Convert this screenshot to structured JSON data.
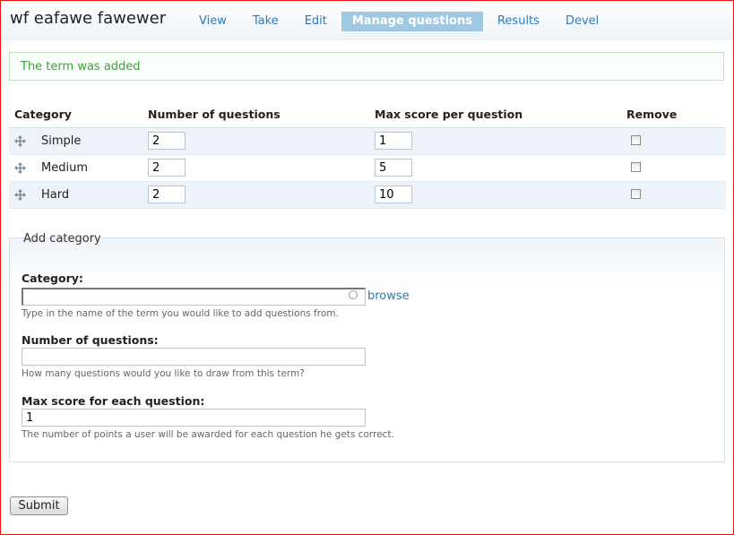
{
  "site": {
    "title": "wf eafawe fawewer"
  },
  "tabs": [
    {
      "label": "View",
      "active": false
    },
    {
      "label": "Take",
      "active": false
    },
    {
      "label": "Edit",
      "active": false
    },
    {
      "label": "Manage questions",
      "active": true
    },
    {
      "label": "Results",
      "active": false
    },
    {
      "label": "Devel",
      "active": false
    }
  ],
  "message": {
    "text": "The term was added"
  },
  "table": {
    "headers": {
      "category": "Category",
      "number": "Number of questions",
      "max_score": "Max score per question",
      "remove": "Remove"
    },
    "rows": [
      {
        "category": "Simple",
        "number": "2",
        "max_score": "1",
        "remove": false
      },
      {
        "category": "Medium",
        "number": "2",
        "max_score": "5",
        "remove": false
      },
      {
        "category": "Hard",
        "number": "2",
        "max_score": "10",
        "remove": false
      }
    ]
  },
  "add_category": {
    "legend": "Add category",
    "category": {
      "label": "Category:",
      "value": "",
      "browse": "browse",
      "description": "Type in the name of the term you would like to add questions from."
    },
    "number": {
      "label": "Number of questions:",
      "value": "",
      "description": "How many questions would you like to draw from this term?"
    },
    "max_score": {
      "label": "Max score for each question:",
      "value": "1",
      "description": "The number of points a user will be awarded for each question he gets correct."
    }
  },
  "submit": {
    "label": "Submit"
  },
  "colors": {
    "accent": "#2c7bb6",
    "active_tab": "#9ec8e3",
    "status_text": "#3aa13a",
    "frame_border": "#e11111",
    "row_alt": "#edf3f9"
  },
  "icons": {
    "drag_handle": "drag-handle-icon",
    "throbber": "autocomplete-throbber-icon"
  }
}
